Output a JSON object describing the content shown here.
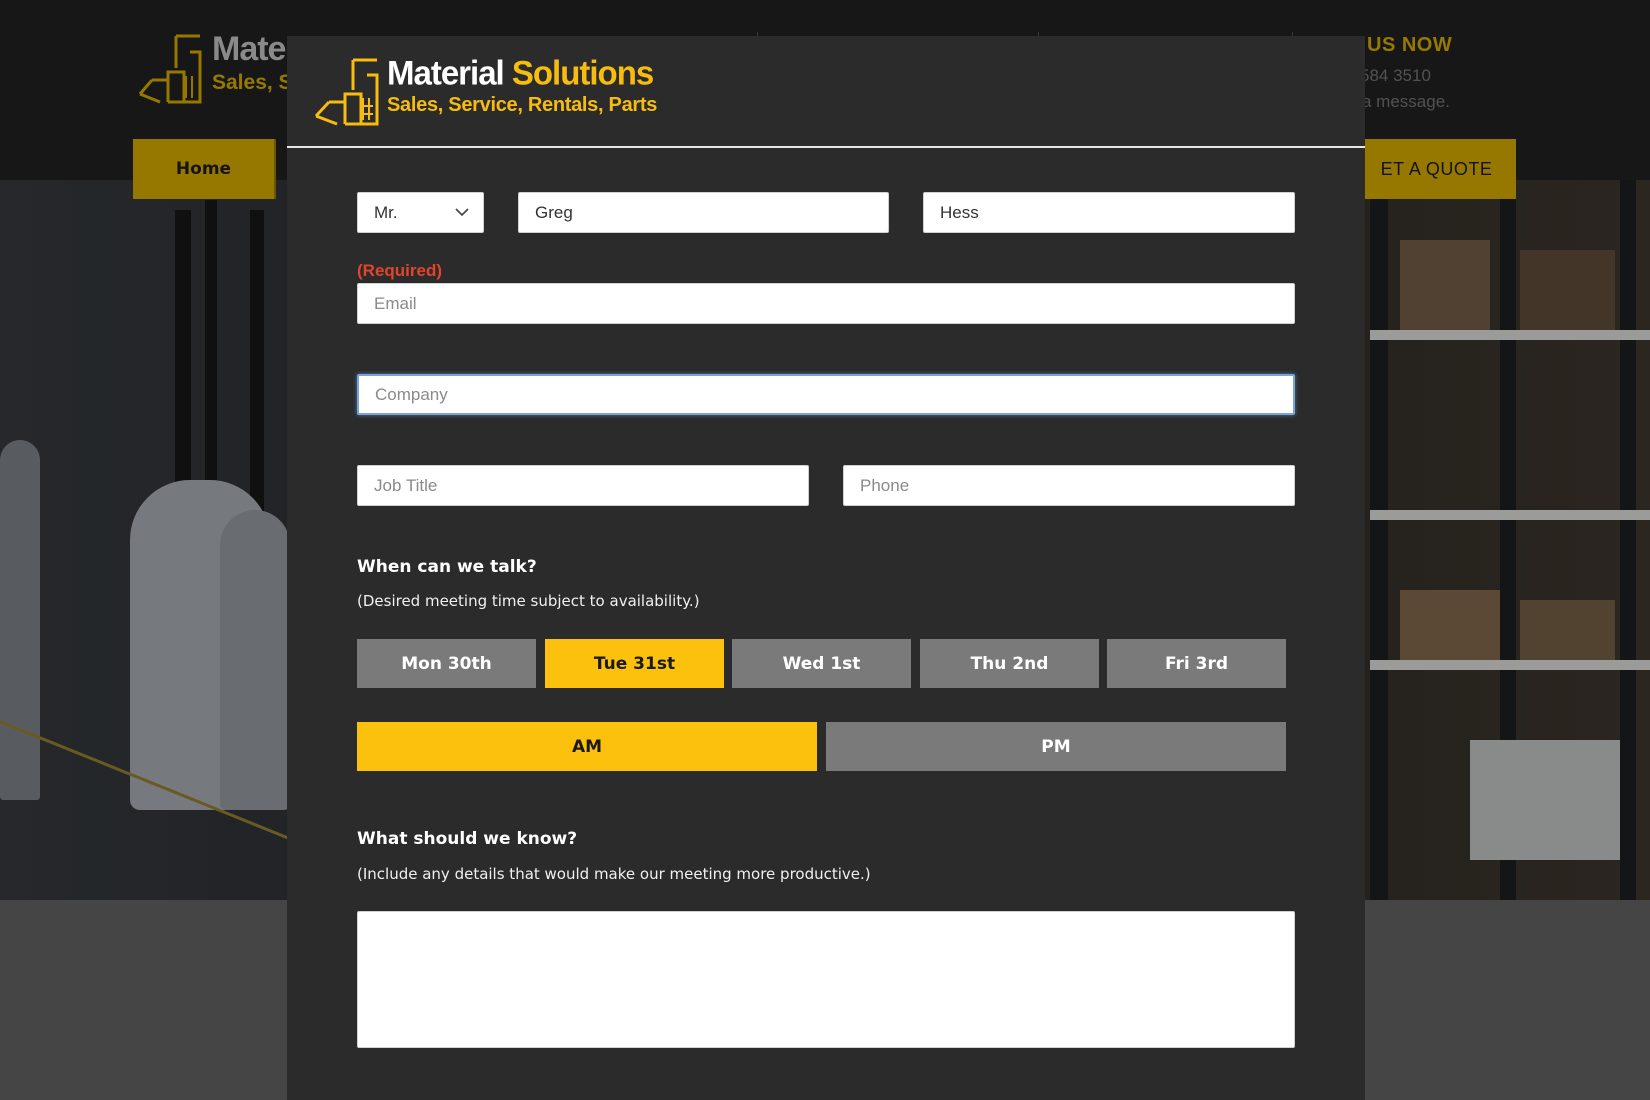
{
  "background": {
    "logo": {
      "title_partial": "Mater",
      "subtitle_partial": "Sales, Se"
    },
    "contact": {
      "heading_partial": "US NOW",
      "phone_partial": "584 3510",
      "message_partial": "a message."
    },
    "nav": {
      "home_label": "Home",
      "quote_label": "ET A QUOTE"
    },
    "accent_color": "#c9a000"
  },
  "modal": {
    "logo": {
      "title_white": "Material",
      "title_yellow": "Solutions",
      "subtitle": "Sales, Service, Rentals, Parts"
    },
    "form": {
      "salutation": {
        "value": "Mr.",
        "options": [
          "Mr."
        ]
      },
      "first_name": {
        "value": "Greg"
      },
      "last_name": {
        "value": "Hess"
      },
      "required_label": "(Required)",
      "email": {
        "placeholder": "Email"
      },
      "company": {
        "placeholder": "Company",
        "focused": true
      },
      "job_title": {
        "placeholder": "Job Title"
      },
      "phone": {
        "placeholder": "Phone"
      },
      "when": {
        "title": "When can we talk?",
        "subtitle": "(Desired meeting time subject to availability.)",
        "days": [
          "Mon 30th",
          "Tue 31st",
          "Wed 1st",
          "Thu 2nd",
          "Fri 3rd"
        ],
        "selected_day": "Tue 31st",
        "periods": [
          "AM",
          "PM"
        ],
        "selected_period": "AM"
      },
      "what": {
        "title": "What should we know?",
        "subtitle": "(Include any details that would make our meeting more productive.)"
      }
    },
    "colors": {
      "accent": "#fcc10d",
      "inactive_button": "#7a7a7a",
      "required": "#e0452c",
      "focus_ring": "#7ba3d6"
    }
  }
}
